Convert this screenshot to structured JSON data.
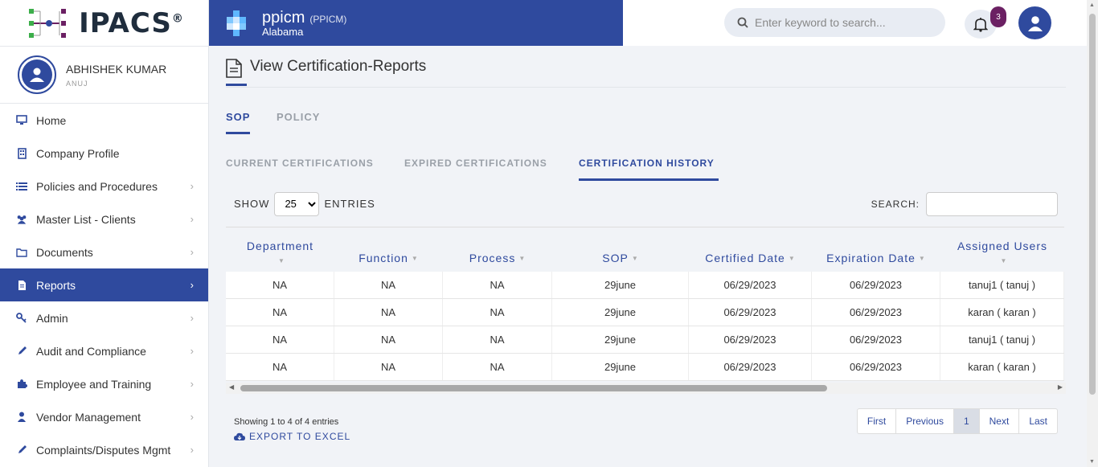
{
  "app": {
    "logo_text": "IPACS",
    "logo_reg": "®"
  },
  "brand": {
    "title": "ppicm",
    "code": "(PPICM)",
    "state": "Alabama"
  },
  "topbar": {
    "search_placeholder": "Enter keyword to search...",
    "notification_count": "3"
  },
  "user": {
    "name": "ABHISHEK KUMAR",
    "sub": "ANUJ"
  },
  "sidebar": {
    "items": [
      {
        "label": "Home",
        "icon": "monitor-icon",
        "chevron": false
      },
      {
        "label": "Company Profile",
        "icon": "building-icon",
        "chevron": false
      },
      {
        "label": "Policies and Procedures",
        "icon": "list-icon",
        "chevron": true
      },
      {
        "label": "Master List - Clients",
        "icon": "users-icon",
        "chevron": true
      },
      {
        "label": "Documents",
        "icon": "folder-icon",
        "chevron": true
      },
      {
        "label": "Reports",
        "icon": "file-icon",
        "chevron": true,
        "active": true
      },
      {
        "label": "Admin",
        "icon": "key-icon",
        "chevron": true
      },
      {
        "label": "Audit and Compliance",
        "icon": "pencil-icon",
        "chevron": true
      },
      {
        "label": "Employee and Training",
        "icon": "puzzle-icon",
        "chevron": true
      },
      {
        "label": "Vendor Management",
        "icon": "user-icon",
        "chevron": true
      },
      {
        "label": "Complaints/Disputes Mgmt",
        "icon": "pencil-icon",
        "chevron": true
      }
    ]
  },
  "page": {
    "title": "View Certification-Reports"
  },
  "tabs_primary": [
    "SOP",
    "POLICY"
  ],
  "tabs_secondary": [
    "CURRENT CERTIFICATIONS",
    "EXPIRED CERTIFICATIONS",
    "CERTIFICATION HISTORY"
  ],
  "table_controls": {
    "show": "SHOW",
    "entries": "ENTRIES",
    "page_size": "25",
    "search": "SEARCH:"
  },
  "table": {
    "headers": [
      "Department",
      "Function",
      "Process",
      "SOP",
      "Certified Date",
      "Expiration Date",
      "Assigned Users"
    ],
    "rows": [
      [
        "NA",
        "NA",
        "NA",
        "29june",
        "06/29/2023",
        "06/29/2023",
        "tanuj1 ( tanuj )"
      ],
      [
        "NA",
        "NA",
        "NA",
        "29june",
        "06/29/2023",
        "06/29/2023",
        "karan ( karan )"
      ],
      [
        "NA",
        "NA",
        "NA",
        "29june",
        "06/29/2023",
        "06/29/2023",
        "tanuj1 ( tanuj )"
      ],
      [
        "NA",
        "NA",
        "NA",
        "29june",
        "06/29/2023",
        "06/29/2023",
        "karan ( karan )"
      ]
    ]
  },
  "footer": {
    "info": "Showing 1 to 4 of 4 entries",
    "export": "EXPORT TO EXCEL",
    "pager": [
      "First",
      "Previous",
      "1",
      "Next",
      "Last"
    ]
  }
}
